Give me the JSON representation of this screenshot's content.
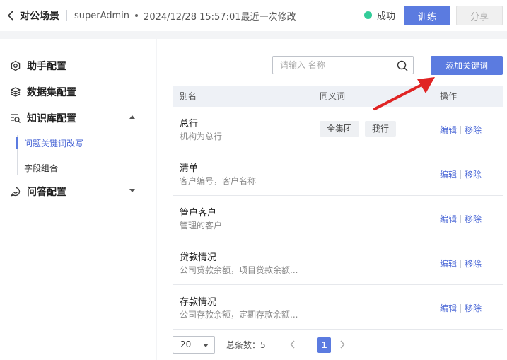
{
  "header": {
    "back_icon": "chevron-left-icon",
    "title": "对公场景",
    "user": "superAdmin",
    "modified": "2024/12/28 15:57:01最近一次修改",
    "status": {
      "label": "成功",
      "color": "#33cc99"
    },
    "train_label": "训练",
    "share_label": "分享"
  },
  "sidebar": {
    "items": [
      {
        "label": "助手配置",
        "icon": "settings-hex-icon"
      },
      {
        "label": "数据集配置",
        "icon": "layers-icon"
      },
      {
        "label": "知识库配置",
        "icon": "knowledge-search-icon",
        "expanded": true
      },
      {
        "label": "问答配置",
        "icon": "chat-bubble-icon",
        "expanded": false
      }
    ],
    "subitems": [
      {
        "label": "问题关键词改写",
        "active": true
      },
      {
        "label": "字段组合",
        "active": false
      }
    ]
  },
  "toolbar": {
    "search_placeholder": "请输入 名称",
    "add_label": "添加关键词"
  },
  "table": {
    "headers": {
      "alias": "别名",
      "synonyms": "同义词",
      "actions": "操作"
    },
    "rows": [
      {
        "alias": "总行",
        "desc": "机构为总行",
        "synonyms": [
          "全集团",
          "我行"
        ]
      },
      {
        "alias": "清单",
        "desc": "客户编号，客户名称",
        "synonyms": []
      },
      {
        "alias": "管户客户",
        "desc": "管理的客户",
        "synonyms": []
      },
      {
        "alias": "贷款情况",
        "desc": "公司贷款余额，项目贷款余额...",
        "synonyms": []
      },
      {
        "alias": "存款情况",
        "desc": "公司存款余额，定期存款余额...",
        "synonyms": []
      }
    ],
    "edit_label": "编辑",
    "remove_label": "移除"
  },
  "pagination": {
    "page_size": "20",
    "total_label": "总条数：",
    "total": "5",
    "current_page": "1"
  },
  "colors": {
    "primary": "#5b7be0",
    "link": "#4a67d6",
    "annotation": "#e02424"
  }
}
